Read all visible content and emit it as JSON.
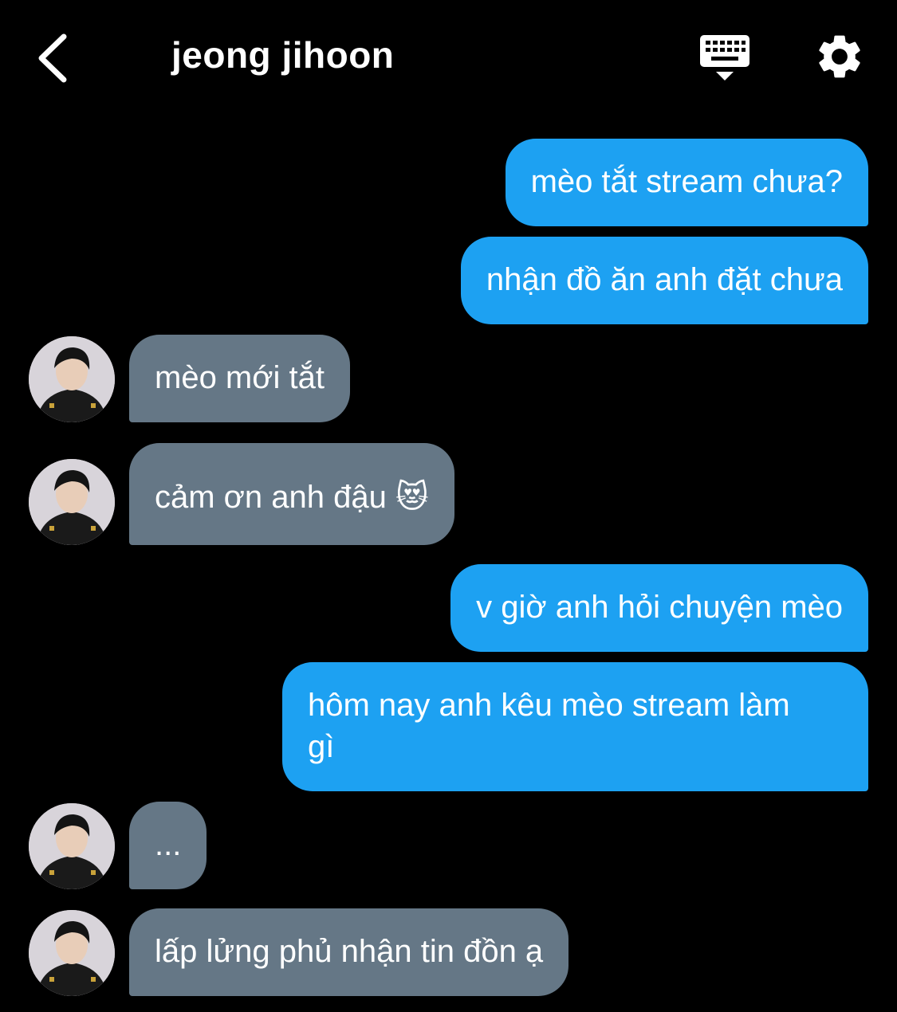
{
  "header": {
    "title": "jeong jihoon",
    "back_icon": "chevron-left-icon",
    "keyboard_icon": "keyboard-icon",
    "settings_icon": "gear-icon"
  },
  "messages": [
    {
      "direction": "outgoing",
      "text": "mèo tắt stream chưa?"
    },
    {
      "direction": "outgoing",
      "text": "nhận đồ ăn anh đặt chưa"
    },
    {
      "direction": "incoming",
      "text": "mèo mới tắt"
    },
    {
      "direction": "incoming",
      "text": "cảm ơn anh đậu 😻"
    },
    {
      "direction": "outgoing",
      "text": "v giờ anh hỏi chuyện mèo"
    },
    {
      "direction": "outgoing",
      "text": "hôm nay anh kêu mèo stream làm\ngì"
    },
    {
      "direction": "incoming",
      "text": "..."
    },
    {
      "direction": "incoming",
      "text": "lấp lửng phủ nhận tin đồn ạ"
    }
  ],
  "colors": {
    "background": "#000000",
    "outgoing_bubble": "#1da1f2",
    "incoming_bubble": "#657786",
    "text": "#ffffff"
  }
}
